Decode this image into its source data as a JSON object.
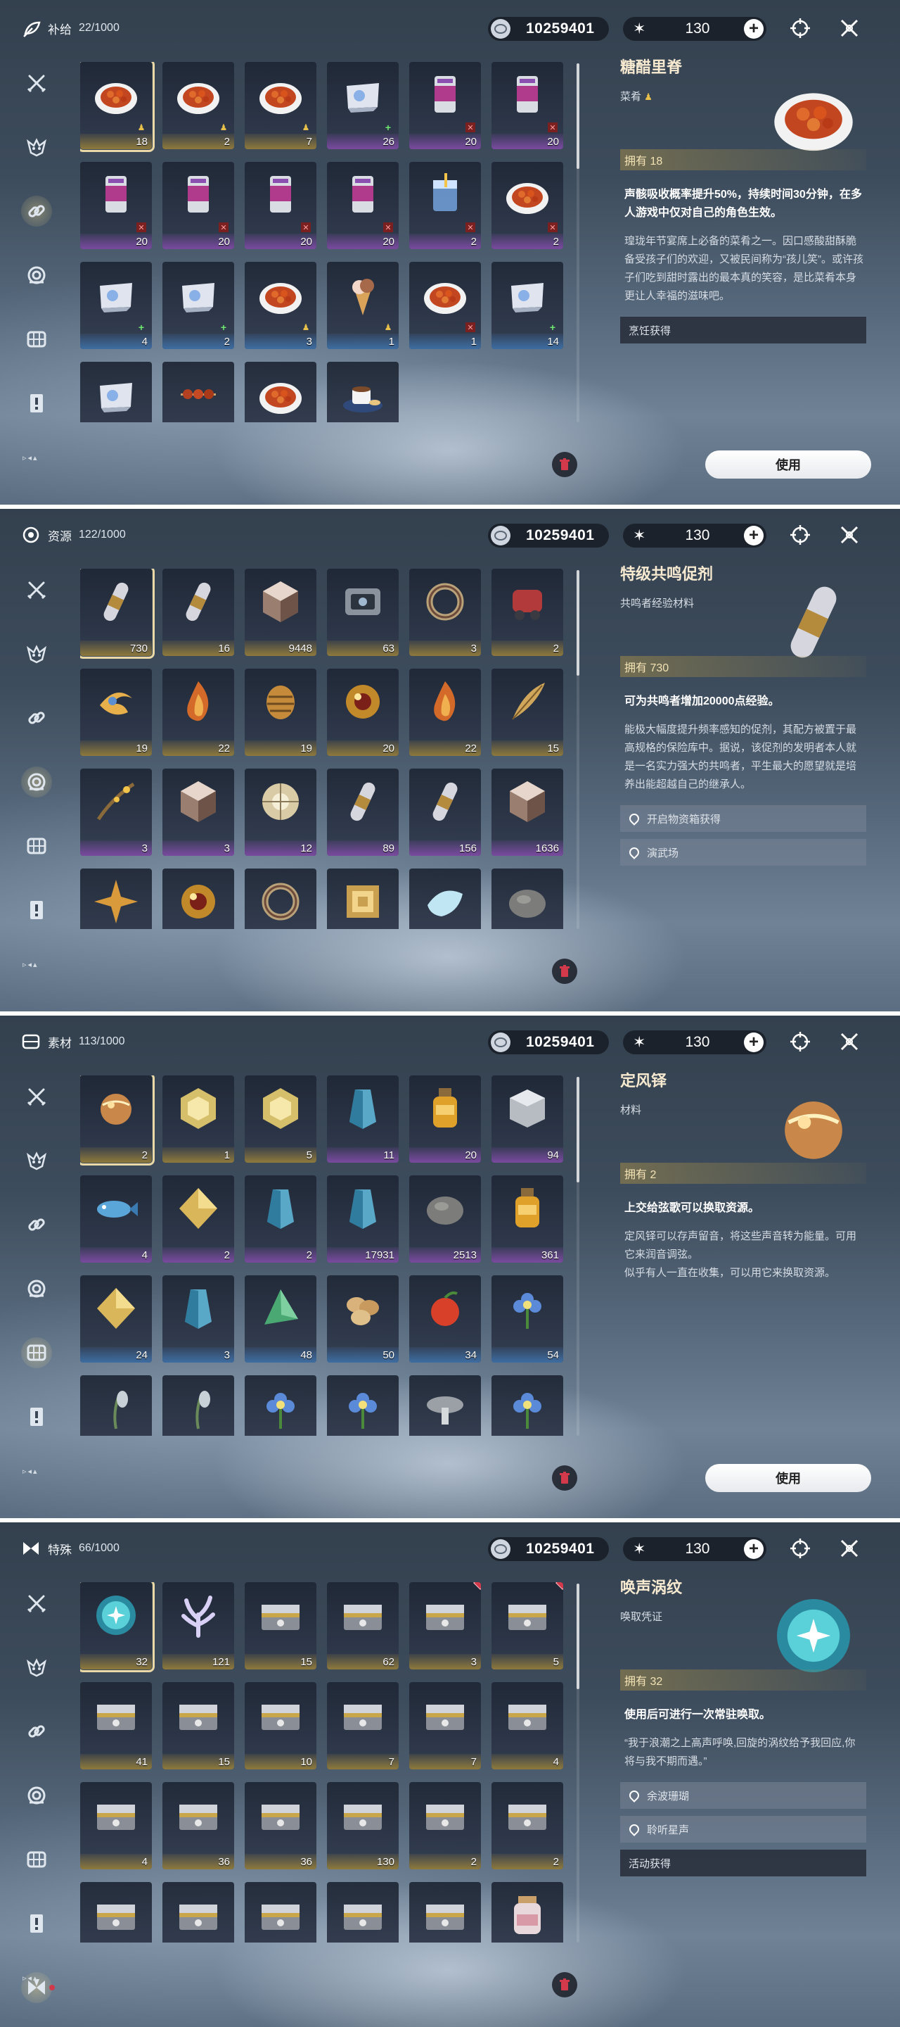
{
  "colors": {
    "gold": "#ead9a7",
    "purple": "#7a4aa0",
    "blue": "#3d6da2",
    "green": "#4d7a55",
    "alert": "#d23a4c"
  },
  "panels": [
    {
      "category": {
        "name": "补给",
        "count": "22/1000",
        "icon": "supply-icon"
      },
      "currency": {
        "coins": "10259401",
        "stars": "130"
      },
      "active_tab": 2,
      "items": [
        {
          "icon": "food-dish-icon",
          "count": "18",
          "rarity": "gold",
          "badge": "person",
          "selected": true
        },
        {
          "icon": "food-dish-icon",
          "count": "2",
          "rarity": "gold",
          "badge": "person"
        },
        {
          "icon": "food-dish-icon",
          "count": "7",
          "rarity": "gold",
          "badge": "person"
        },
        {
          "icon": "potion-pack-icon",
          "count": "26",
          "rarity": "purple",
          "badge": "plus"
        },
        {
          "icon": "drink-can-icon",
          "count": "20",
          "rarity": "purple",
          "badge": "x"
        },
        {
          "icon": "drink-can-icon",
          "count": "20",
          "rarity": "purple",
          "badge": "x"
        },
        {
          "icon": "drink-can-icon",
          "count": "20",
          "rarity": "purple",
          "badge": "x"
        },
        {
          "icon": "drink-can-icon",
          "count": "20",
          "rarity": "purple",
          "badge": "x"
        },
        {
          "icon": "drink-can-icon",
          "count": "20",
          "rarity": "purple",
          "badge": "x"
        },
        {
          "icon": "drink-can-icon",
          "count": "20",
          "rarity": "purple",
          "badge": "x"
        },
        {
          "icon": "drink-glass-icon",
          "count": "2",
          "rarity": "purple",
          "badge": "x"
        },
        {
          "icon": "food-dish-icon",
          "count": "2",
          "rarity": "purple",
          "badge": "x"
        },
        {
          "icon": "potion-pack-icon",
          "count": "4",
          "rarity": "blue",
          "badge": "plus"
        },
        {
          "icon": "potion-pack-icon",
          "count": "2",
          "rarity": "blue",
          "badge": "plus"
        },
        {
          "icon": "food-dish-icon",
          "count": "3",
          "rarity": "blue",
          "badge": "person"
        },
        {
          "icon": "ice-cream-icon",
          "count": "1",
          "rarity": "blue",
          "badge": "person"
        },
        {
          "icon": "food-dish-icon",
          "count": "1",
          "rarity": "blue",
          "badge": "x"
        },
        {
          "icon": "potion-pack-icon",
          "count": "14",
          "rarity": "blue",
          "badge": "plus"
        },
        {
          "icon": "potion-pack-icon",
          "count": "",
          "rarity": "green",
          "badge": "plus"
        },
        {
          "icon": "skewer-icon",
          "count": "",
          "rarity": "green",
          "badge": "x"
        },
        {
          "icon": "food-dish-icon",
          "count": "",
          "rarity": "green",
          "badge": "person"
        },
        {
          "icon": "coffee-cup-icon",
          "count": "",
          "rarity": "green",
          "badge": "person"
        }
      ],
      "detail": {
        "name": "糖醋里脊",
        "type": "菜肴",
        "type_badge": true,
        "icon": "food-dish-icon",
        "own": "拥有 18",
        "effect": "声骸吸收概率提升50%，持续时间30分钟，在多人游戏中仅对自己的角色生效。",
        "desc": "瑝珑年节宴席上必备的菜肴之一。因口感酸甜酥脆备受孩子们的欢迎，又被民间称为“孩儿笑”。或许孩子们吃到甜时露出的最本真的笑容，是比菜肴本身更让人幸福的滋味吧。",
        "sources": [
          {
            "text": "烹饪获得",
            "loc": false
          }
        ],
        "use_label": "使用"
      }
    },
    {
      "category": {
        "name": "资源",
        "count": "122/1000",
        "icon": "resource-icon"
      },
      "currency": {
        "coins": "10259401",
        "stars": "130"
      },
      "active_tab": 3,
      "items": [
        {
          "icon": "capsule-icon",
          "count": "730",
          "rarity": "gold",
          "selected": true
        },
        {
          "icon": "capsule-icon",
          "count": "16",
          "rarity": "gold"
        },
        {
          "icon": "crystal-cube-icon",
          "count": "9448",
          "rarity": "gold"
        },
        {
          "icon": "device-icon",
          "count": "63",
          "rarity": "gold"
        },
        {
          "icon": "ring-icon",
          "count": "3",
          "rarity": "gold"
        },
        {
          "icon": "machine-icon",
          "count": "2",
          "rarity": "gold"
        },
        {
          "icon": "swirl-icon",
          "count": "19",
          "rarity": "gold"
        },
        {
          "icon": "flame-icon",
          "count": "22",
          "rarity": "gold"
        },
        {
          "icon": "shell-icon",
          "count": "19",
          "rarity": "gold"
        },
        {
          "icon": "orb-icon",
          "count": "20",
          "rarity": "gold"
        },
        {
          "icon": "flame-icon",
          "count": "22",
          "rarity": "gold"
        },
        {
          "icon": "feather-icon",
          "count": "15",
          "rarity": "gold"
        },
        {
          "icon": "branch-icon",
          "count": "3",
          "rarity": "purple"
        },
        {
          "icon": "crystal-cube-icon",
          "count": "3",
          "rarity": "purple"
        },
        {
          "icon": "disc-icon",
          "count": "12",
          "rarity": "purple"
        },
        {
          "icon": "capsule-icon",
          "count": "89",
          "rarity": "purple"
        },
        {
          "icon": "capsule-icon",
          "count": "156",
          "rarity": "purple"
        },
        {
          "icon": "crystal-cube-icon",
          "count": "1636",
          "rarity": "purple"
        },
        {
          "icon": "star-shard-icon",
          "count": "",
          "rarity": "gold"
        },
        {
          "icon": "orb-icon",
          "count": "",
          "rarity": "gold"
        },
        {
          "icon": "ring-icon",
          "count": "",
          "rarity": "gold"
        },
        {
          "icon": "spiral-icon",
          "count": "",
          "rarity": "gold"
        },
        {
          "icon": "petal-icon",
          "count": "",
          "rarity": "gold"
        },
        {
          "icon": "stone-icon",
          "count": "",
          "rarity": "gold"
        }
      ],
      "detail": {
        "name": "特级共鸣促剂",
        "type": "共鸣者经验材料",
        "type_badge": false,
        "icon": "capsule-icon",
        "own": "拥有 730",
        "effect": "可为共鸣者增加20000点经验。",
        "desc": "能极大幅度提升频率感知的促剂，其配方被置于最高规格的保险库中。据说，该促剂的发明者本人就是一名实力强大的共鸣者，平生最大的愿望就是培养出能超越自己的继承人。",
        "sources": [
          {
            "text": "开启物资箱获得",
            "loc": true
          },
          {
            "text": "演武场",
            "loc": true
          }
        ],
        "use_label": ""
      }
    },
    {
      "category": {
        "name": "素材",
        "count": "113/1000",
        "icon": "material-icon"
      },
      "currency": {
        "coins": "10259401",
        "stars": "130"
      },
      "active_tab": 4,
      "items": [
        {
          "icon": "sphere-icon",
          "count": "2",
          "rarity": "gold",
          "selected": true
        },
        {
          "icon": "hexagon-icon",
          "count": "1",
          "rarity": "gold"
        },
        {
          "icon": "hexagon-icon",
          "count": "5",
          "rarity": "gold"
        },
        {
          "icon": "crystal-shard-icon",
          "count": "11",
          "rarity": "purple"
        },
        {
          "icon": "bottle-icon",
          "count": "20",
          "rarity": "purple"
        },
        {
          "icon": "cube-icon",
          "count": "94",
          "rarity": "purple"
        },
        {
          "icon": "fish-icon",
          "count": "4",
          "rarity": "purple"
        },
        {
          "icon": "diamond-icon",
          "count": "2",
          "rarity": "purple"
        },
        {
          "icon": "crystal-shard-icon",
          "count": "2",
          "rarity": "purple"
        },
        {
          "icon": "crystal-shard-icon",
          "count": "17931",
          "rarity": "purple"
        },
        {
          "icon": "stone-icon",
          "count": "2513",
          "rarity": "purple"
        },
        {
          "icon": "bottle-icon",
          "count": "361",
          "rarity": "purple"
        },
        {
          "icon": "diamond-icon",
          "count": "24",
          "rarity": "blue"
        },
        {
          "icon": "crystal-shard-icon",
          "count": "3",
          "rarity": "blue"
        },
        {
          "icon": "triangle-icon",
          "count": "48",
          "rarity": "blue"
        },
        {
          "icon": "nut-icon",
          "count": "50",
          "rarity": "blue"
        },
        {
          "icon": "fruit-icon",
          "count": "34",
          "rarity": "blue"
        },
        {
          "icon": "flower-icon",
          "count": "54",
          "rarity": "blue"
        },
        {
          "icon": "herb-icon",
          "count": "",
          "rarity": "gray"
        },
        {
          "icon": "herb-icon",
          "count": "",
          "rarity": "gray"
        },
        {
          "icon": "flower-icon",
          "count": "",
          "rarity": "gray"
        },
        {
          "icon": "flower-icon",
          "count": "",
          "rarity": "gray"
        },
        {
          "icon": "mushroom-icon",
          "count": "",
          "rarity": "gray"
        },
        {
          "icon": "flower-icon",
          "count": "",
          "rarity": "gray"
        }
      ],
      "detail": {
        "name": "定风铎",
        "type": "材料",
        "type_badge": false,
        "icon": "sphere-icon",
        "own": "拥有 2",
        "effect": "上交给弦歌可以换取资源。",
        "desc": "定风铎可以存声留音，将这些声音转为能量。可用它来润音调弦。\n似乎有人一直在收集，可以用它来换取资源。",
        "sources": [],
        "use_label": "使用"
      }
    },
    {
      "category": {
        "name": "特殊",
        "count": "66/1000",
        "icon": "special-icon"
      },
      "currency": {
        "coins": "10259401",
        "stars": "130"
      },
      "active_tab": 6,
      "items": [
        {
          "icon": "swirl-orb-icon",
          "count": "32",
          "rarity": "gold",
          "selected": true
        },
        {
          "icon": "coral-icon",
          "count": "121",
          "rarity": "gold"
        },
        {
          "icon": "chest-icon",
          "count": "15",
          "rarity": "gold"
        },
        {
          "icon": "chest-icon",
          "count": "62",
          "rarity": "gold"
        },
        {
          "icon": "chest-icon",
          "count": "3",
          "rarity": "gold",
          "alert": true
        },
        {
          "icon": "chest-icon",
          "count": "5",
          "rarity": "gold",
          "alert": true
        },
        {
          "icon": "chest-icon",
          "count": "41",
          "rarity": "gold"
        },
        {
          "icon": "chest-icon",
          "count": "15",
          "rarity": "gold"
        },
        {
          "icon": "chest-icon",
          "count": "10",
          "rarity": "gold"
        },
        {
          "icon": "chest-icon",
          "count": "7",
          "rarity": "gold"
        },
        {
          "icon": "chest-icon",
          "count": "7",
          "rarity": "gold"
        },
        {
          "icon": "chest-icon",
          "count": "4",
          "rarity": "gold"
        },
        {
          "icon": "chest-icon",
          "count": "4",
          "rarity": "gold"
        },
        {
          "icon": "chest-icon",
          "count": "36",
          "rarity": "gold"
        },
        {
          "icon": "chest-icon",
          "count": "36",
          "rarity": "gold"
        },
        {
          "icon": "chest-icon",
          "count": "130",
          "rarity": "gold"
        },
        {
          "icon": "chest-icon",
          "count": "2",
          "rarity": "gold"
        },
        {
          "icon": "chest-icon",
          "count": "2",
          "rarity": "gold"
        },
        {
          "icon": "chest-icon",
          "count": "",
          "rarity": "gold"
        },
        {
          "icon": "chest-icon",
          "count": "",
          "rarity": "gold"
        },
        {
          "icon": "chest-icon",
          "count": "",
          "rarity": "gold"
        },
        {
          "icon": "chest-icon",
          "count": "",
          "rarity": "gold"
        },
        {
          "icon": "chest-icon",
          "count": "",
          "rarity": "gold"
        },
        {
          "icon": "jar-icon",
          "count": "",
          "rarity": "gold"
        }
      ],
      "detail": {
        "name": "唤声涡纹",
        "type": "唤取凭证",
        "type_badge": false,
        "icon": "swirl-orb-icon",
        "own": "拥有 32",
        "effect": "使用后可进行一次常驻唤取。",
        "desc": "“我于浪潮之上高声呼唤,回旋的涡纹给予我回应,你将与我不期而遇。”",
        "sources": [
          {
            "text": "余波珊瑚",
            "loc": true
          },
          {
            "text": "聆听星声",
            "loc": true
          },
          {
            "text": "活动获得",
            "loc": false
          }
        ],
        "use_label": ""
      }
    }
  ]
}
